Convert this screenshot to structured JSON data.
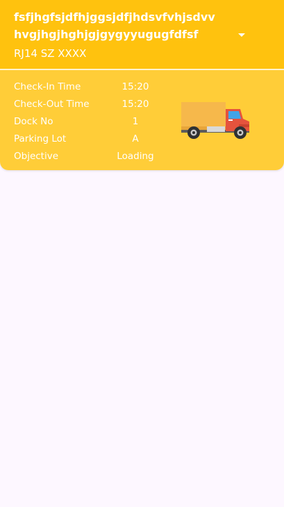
{
  "card": {
    "title": "fsfjhgfsjdfhjggsjdfjhdsvfvhjsdvv hvgjhgjhghjgjgygyyugugfdfsf",
    "plate": "RJ14 SZ XXXX",
    "expand_icon": "caret-down-icon",
    "truck_icon": "truck-icon",
    "rows": [
      {
        "label": "Check-In Time",
        "value": "15:20"
      },
      {
        "label": "Check-Out Time",
        "value": "15:20"
      },
      {
        "label": "Dock No",
        "value": "1"
      },
      {
        "label": "Parking Lot",
        "value": "A"
      },
      {
        "label": "Objective",
        "value": "Loading"
      }
    ]
  },
  "colors": {
    "header": "#ffc20e",
    "body": "#ffcd38",
    "background": "#fdf7ff"
  }
}
